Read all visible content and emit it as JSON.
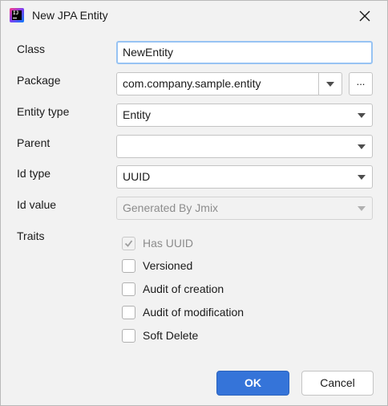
{
  "window": {
    "title": "New JPA Entity"
  },
  "form": {
    "class_label": "Class",
    "class_value": "NewEntity",
    "package_label": "Package",
    "package_value": "com.company.sample.entity",
    "browse_label": "...",
    "entity_type_label": "Entity type",
    "entity_type_value": "Entity",
    "parent_label": "Parent",
    "parent_value": "",
    "id_type_label": "Id type",
    "id_type_value": "UUID",
    "id_value_label": "Id value",
    "id_value_value": "Generated By Jmix",
    "traits_label": "Traits"
  },
  "traits": [
    {
      "label": "Has UUID",
      "checked": true,
      "disabled": true
    },
    {
      "label": "Versioned",
      "checked": false,
      "disabled": false
    },
    {
      "label": "Audit of creation",
      "checked": false,
      "disabled": false
    },
    {
      "label": "Audit of modification",
      "checked": false,
      "disabled": false
    },
    {
      "label": "Soft Delete",
      "checked": false,
      "disabled": false
    }
  ],
  "buttons": {
    "ok_label": "OK",
    "cancel_label": "Cancel"
  },
  "colors": {
    "accent": "#3574d9",
    "focus_border": "#97c3f3",
    "background": "#f2f2f2"
  },
  "icons": {
    "app": "intellij-app-icon",
    "close": "close-icon",
    "dropdown": "chevron-down-icon",
    "check": "checkmark-icon"
  }
}
